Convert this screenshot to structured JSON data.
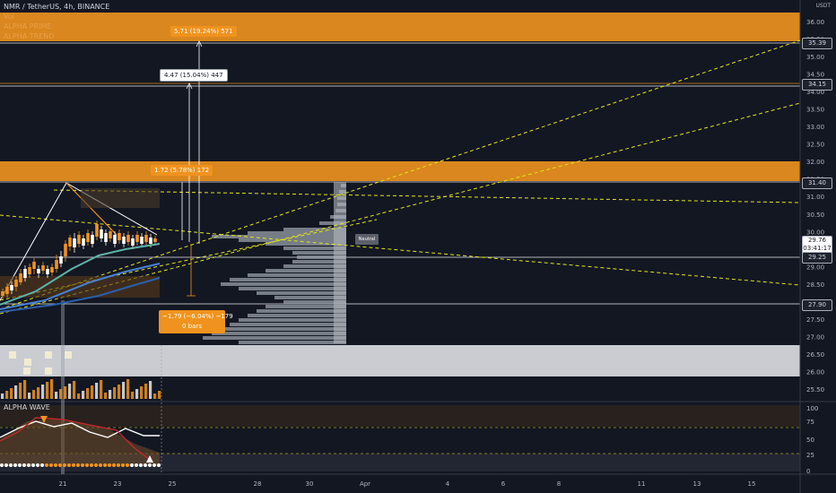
{
  "legend": {
    "symbol": "NMR / TetherUS, 4h, BINANCE",
    "indicators": [
      "Vol",
      "ALPHA PRIME",
      "ALPHA TREND"
    ]
  },
  "currency": "USDT",
  "price_axis_ticks": [
    "36.00",
    "35.50",
    "35.00",
    "34.50",
    "34.00",
    "33.50",
    "33.00",
    "32.50",
    "32.00",
    "31.50",
    "31.00",
    "30.50",
    "30.00",
    "29.50",
    "29.00",
    "28.50",
    "28.00",
    "27.50",
    "27.00",
    "26.50",
    "26.00",
    "25.50"
  ],
  "price_labels": {
    "level_1": "35.39",
    "level_2": "34.15",
    "level_3": "31.40",
    "current_price": "29.76",
    "countdown": "03:41:17",
    "level_4": "29.25",
    "level_5": "27.90"
  },
  "oscillator": {
    "title": "ALPHA WAVE",
    "ticks": [
      "100",
      "75",
      "50",
      "25",
      "0"
    ]
  },
  "time_axis": [
    "21",
    "23",
    "25",
    "28",
    "30",
    "Apr",
    "4",
    "6",
    "8",
    "11",
    "13",
    "15"
  ],
  "measure_labels": {
    "top": "5.71 (19.24%) 571",
    "mid": "4.47 (15.04%) 447",
    "lower": "1.72 (5.78%) 172",
    "down_line1": "−1.79 (−6.04%) −179",
    "down_line2": "0 bars"
  },
  "neutral_label": "Neutral",
  "colors": {
    "background": "#131722",
    "zone_orange": "#f0931e",
    "up_candle": "#f0931e",
    "down_candle": "#ffffff",
    "trendline_yellow": "#e5e519"
  }
}
